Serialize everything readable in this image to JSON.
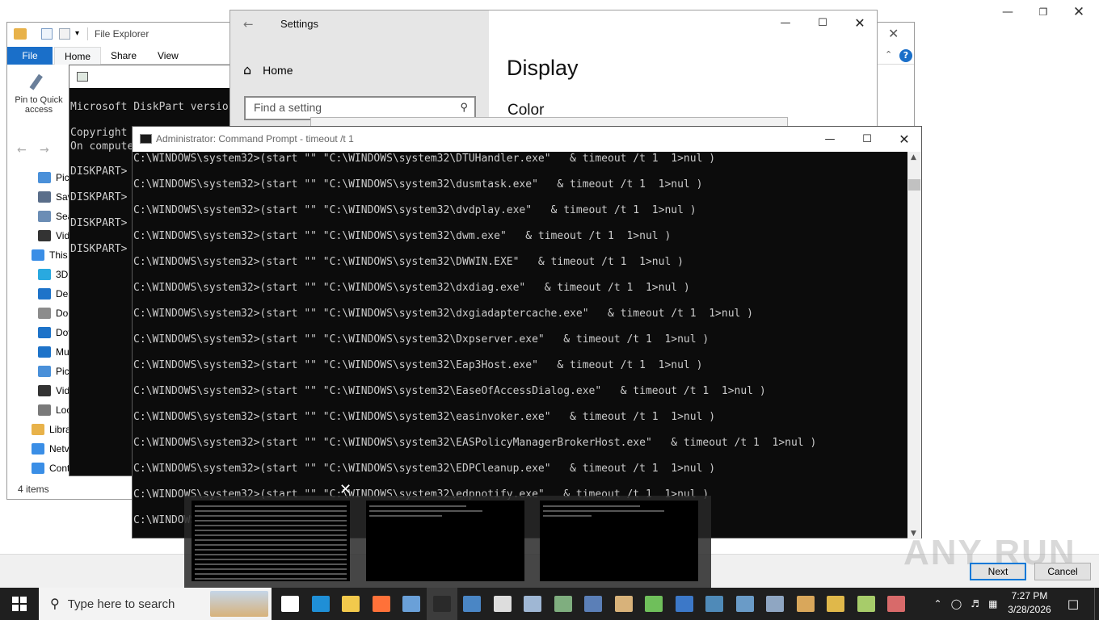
{
  "wizard": {
    "next_label": "Next",
    "cancel_label": "Cancel",
    "watermark": "ANY RUN"
  },
  "explorer": {
    "title": "File Explorer",
    "tabs": [
      {
        "label": "File"
      },
      {
        "label": "Home"
      },
      {
        "label": "Share"
      },
      {
        "label": "View"
      }
    ],
    "pin_label": "Pin to Quick access",
    "nav": [
      {
        "label": "Pic",
        "color": "#4a90d9"
      },
      {
        "label": "Sav",
        "color": "#5a6e8a"
      },
      {
        "label": "Sea",
        "color": "#6b8db5"
      },
      {
        "label": "Vid",
        "color": "#333333"
      },
      {
        "label": "This",
        "color": "#3a8ee6"
      },
      {
        "label": "3D",
        "color": "#29a9e0"
      },
      {
        "label": "Des",
        "color": "#1e73c9"
      },
      {
        "label": "Doc",
        "color": "#8c8c8c"
      },
      {
        "label": "Dov",
        "color": "#1e73c9"
      },
      {
        "label": "Mu",
        "color": "#1e73c9"
      },
      {
        "label": "Pic",
        "color": "#4a90d9"
      },
      {
        "label": "Vid",
        "color": "#333333"
      },
      {
        "label": "Loc",
        "color": "#7a7a7a"
      },
      {
        "label": "Libra",
        "color": "#e8b24a"
      },
      {
        "label": "Netv",
        "color": "#3a8ee6"
      },
      {
        "label": "Cont",
        "color": "#3a8ee6"
      }
    ],
    "status": "4 items"
  },
  "diskpart": {
    "lines": [
      {
        "text": "Microsoft DiskPart versio"
      },
      {
        "text": "Copyright"
      },
      {
        "text": "On compute"
      },
      {
        "text": "DISKPART>"
      },
      {
        "text": "DISKPART>"
      },
      {
        "text": "DISKPART>"
      },
      {
        "text": "DISKPART>"
      }
    ]
  },
  "settings": {
    "title": "Settings",
    "home_label": "Home",
    "search_placeholder": "Find a setting",
    "heading": "Display",
    "subheading": "Color"
  },
  "cmd": {
    "title": "Administrator: Command Prompt - timeout  /t 1",
    "lines": [
      {
        "text": "C:\\WINDOWS\\system32>(start \"\" \"C:\\WINDOWS\\system32\\DTUHandler.exe\"   & timeout /t 1  1>nul )"
      },
      {
        "text": "C:\\WINDOWS\\system32>(start \"\" \"C:\\WINDOWS\\system32\\dusmtask.exe\"   & timeout /t 1  1>nul )"
      },
      {
        "text": "C:\\WINDOWS\\system32>(start \"\" \"C:\\WINDOWS\\system32\\dvdplay.exe\"   & timeout /t 1  1>nul )"
      },
      {
        "text": "C:\\WINDOWS\\system32>(start \"\" \"C:\\WINDOWS\\system32\\dwm.exe\"   & timeout /t 1  1>nul )"
      },
      {
        "text": "C:\\WINDOWS\\system32>(start \"\" \"C:\\WINDOWS\\system32\\DWWIN.EXE\"   & timeout /t 1  1>nul )"
      },
      {
        "text": "C:\\WINDOWS\\system32>(start \"\" \"C:\\WINDOWS\\system32\\dxdiag.exe\"   & timeout /t 1  1>nul )"
      },
      {
        "text": "C:\\WINDOWS\\system32>(start \"\" \"C:\\WINDOWS\\system32\\dxgiadaptercache.exe\"   & timeout /t 1  1>nul )"
      },
      {
        "text": "C:\\WINDOWS\\system32>(start \"\" \"C:\\WINDOWS\\system32\\Dxpserver.exe\"   & timeout /t 1  1>nul )"
      },
      {
        "text": "C:\\WINDOWS\\system32>(start \"\" \"C:\\WINDOWS\\system32\\Eap3Host.exe\"   & timeout /t 1  1>nul )"
      },
      {
        "text": "C:\\WINDOWS\\system32>(start \"\" \"C:\\WINDOWS\\system32\\EaseOfAccessDialog.exe\"   & timeout /t 1  1>nul )"
      },
      {
        "text": "C:\\WINDOWS\\system32>(start \"\" \"C:\\WINDOWS\\system32\\easinvoker.exe\"   & timeout /t 1  1>nul )"
      },
      {
        "text": "C:\\WINDOWS\\system32>(start \"\" \"C:\\WINDOWS\\system32\\EASPolicyManagerBrokerHost.exe\"   & timeout /t 1  1>nul )"
      },
      {
        "text": "C:\\WINDOWS\\system32>(start \"\" \"C:\\WINDOWS\\system32\\EDPCleanup.exe\"   & timeout /t 1  1>nul )"
      },
      {
        "text": "C:\\WINDOWS\\system32>(start \"\" \"C:\\WINDOWS\\system32\\edpnotify.exe\"   & timeout /t 1  1>nul )"
      },
      {
        "text": "C:\\WINDOWS"
      }
    ]
  },
  "taskbar": {
    "search_placeholder": "Type here to search",
    "time": "7:27 PM",
    "date": "3/28/2026",
    "apps": [
      {
        "name": "task-view",
        "color": "#ffffff"
      },
      {
        "name": "edge",
        "color": "#1f8fd6"
      },
      {
        "name": "file-explorer",
        "color": "#f2c94c"
      },
      {
        "name": "firefox",
        "color": "#ff7139"
      },
      {
        "name": "window-app",
        "color": "#6aa0d8"
      },
      {
        "name": "command-prompt",
        "color": "#2a2a2a"
      },
      {
        "name": "app-window",
        "color": "#4a86c5"
      },
      {
        "name": "settings",
        "color": "#dddddd"
      },
      {
        "name": "app-x",
        "color": "#9fb7d4"
      },
      {
        "name": "app-book",
        "color": "#7fae7f"
      },
      {
        "name": "app-tool",
        "color": "#5b7fb7"
      },
      {
        "name": "app-box",
        "color": "#d8b27a"
      },
      {
        "name": "app-gear",
        "color": "#6fbf5b"
      },
      {
        "name": "app-monitor",
        "color": "#3c78c8"
      },
      {
        "name": "app-doc",
        "color": "#4f8ab8"
      },
      {
        "name": "app-doc2",
        "color": "#6a9bc7"
      },
      {
        "name": "app-print",
        "color": "#8fa6c2"
      },
      {
        "name": "app-img",
        "color": "#d9a75b"
      },
      {
        "name": "app-key",
        "color": "#e0b84a"
      },
      {
        "name": "app-font",
        "color": "#a7cc6a"
      },
      {
        "name": "app-grid",
        "color": "#d86a6a"
      }
    ]
  }
}
